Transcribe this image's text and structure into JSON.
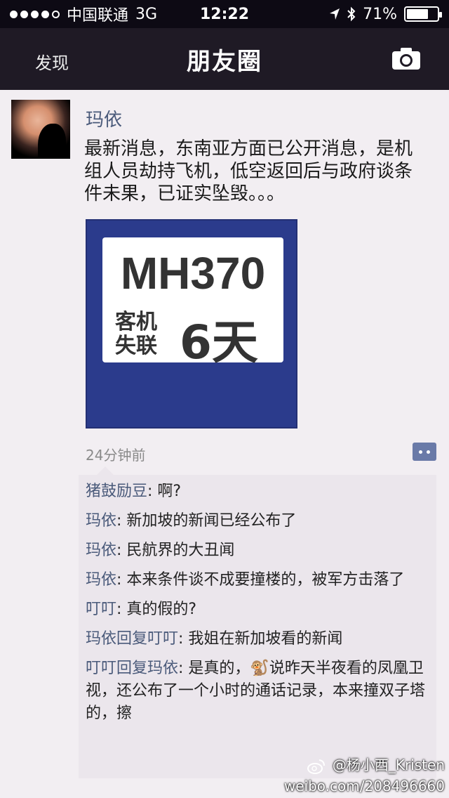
{
  "status_bar": {
    "carrier": "中国联通",
    "network": "3G",
    "time": "12:22",
    "battery": "71%",
    "battery_level": 0.71
  },
  "nav": {
    "back_label": "发现",
    "title": "朋友圈",
    "camera_icon": "camera-icon"
  },
  "post": {
    "username": "玛依",
    "text": "最新消息，东南亚方面已公开消息，是机组人员劫持飞机，低空返回后与政府谈条件未果，已证实坠毁。。。",
    "image": {
      "headline": "MH370",
      "sub": "客机失联",
      "big": "6天"
    },
    "time_ago": "24分钟前"
  },
  "comments": [
    {
      "name": "猪鼓励豆",
      "text": ": 啊?"
    },
    {
      "name": "玛依",
      "text": ": 新加坡的新闻已经公布了"
    },
    {
      "name": "玛依",
      "text": ": 民航界的大丑闻"
    },
    {
      "name": "玛依",
      "text": ": 本来条件谈不成要撞楼的，被军方击落了"
    },
    {
      "name": "叮叮",
      "text": ": 真的假的?"
    },
    {
      "name": "玛依回复叮叮",
      "text": ": 我姐在新加坡看的新闻"
    },
    {
      "name": "叮叮回复玛依",
      "text": ": 是真的，🐒说昨天半夜看的凤凰卫视，还公布了一个小时的通话记录，本来撞双子塔的，擦"
    }
  ],
  "watermark": {
    "handle": "@杨小西_Kristen",
    "url": "weibo.com/208496660"
  },
  "colors": {
    "nav_bg": "#1f1a25",
    "name_color": "#4a5a7a",
    "image_bg": "#2b3b8c"
  }
}
